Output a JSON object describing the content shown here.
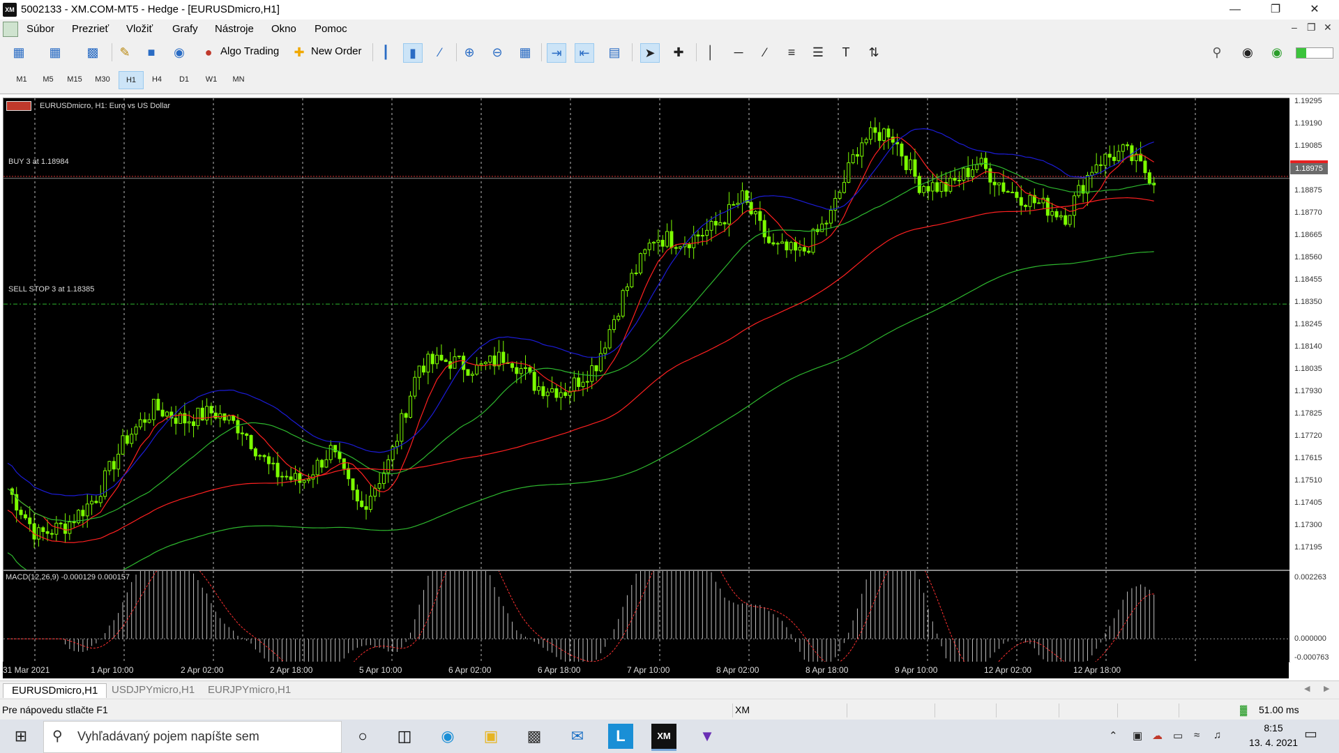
{
  "window": {
    "title": "5002133 - XM.COM-MT5 - Hedge - [EURUSDmicro,H1]",
    "app_icon": "XM"
  },
  "menu": [
    "Súbor",
    "Prezrieť",
    "Vložiť",
    "Grafy",
    "Nástroje",
    "Okno",
    "Pomoc"
  ],
  "toolbar": {
    "algo_trading": "Algo Trading",
    "new_order": "New Order"
  },
  "timeframes": [
    "M1",
    "M5",
    "M15",
    "M30",
    "H1",
    "H4",
    "D1",
    "W1",
    "MN"
  ],
  "active_timeframe": "H1",
  "chart": {
    "symbol_label": "EURUSDmicro, H1:  Euro vs US Dollar",
    "buy_label": "BUY 3 at 1.18984",
    "sell_stop_label": "SELL STOP 3 at 1.18385",
    "current_price": "1.18975",
    "macd_label": "MACD(12,26,9) -0.000129 0.000157",
    "y_labels": [
      "1.19295",
      "1.19190",
      "1.19085",
      "1.18980",
      "1.18875",
      "1.18770",
      "1.18665",
      "1.18560",
      "1.18455",
      "1.18350",
      "1.18245",
      "1.18140",
      "1.18035",
      "1.17930",
      "1.17825",
      "1.17720",
      "1.17615",
      "1.17510",
      "1.17405",
      "1.17300",
      "1.17195"
    ],
    "macd_y_labels": [
      "0.002263",
      "0.000000",
      "-0.000763"
    ],
    "x_labels": [
      "31 Mar 2021",
      "1 Apr 10:00",
      "2 Apr 02:00",
      "2 Apr 18:00",
      "5 Apr 10:00",
      "6 Apr 02:00",
      "6 Apr 18:00",
      "7 Apr 10:00",
      "8 Apr 02:00",
      "8 Apr 18:00",
      "9 Apr 10:00",
      "12 Apr 02:00",
      "12 Apr 18:00"
    ]
  },
  "chart_data": {
    "type": "candlestick",
    "symbol": "EURUSDmicro",
    "timeframe": "H1",
    "ylim": [
      1.1714,
      1.1935
    ],
    "close_approx": [
      1.1752,
      1.173,
      1.1735,
      1.1748,
      1.1775,
      1.179,
      1.1784,
      1.1788,
      1.178,
      1.176,
      1.1755,
      1.177,
      1.1742,
      1.1765,
      1.181,
      1.1812,
      1.1808,
      1.1815,
      1.18,
      1.1798,
      1.181,
      1.1845,
      1.187,
      1.1868,
      1.1874,
      1.1888,
      1.1865,
      1.1862,
      1.188,
      1.1915,
      1.192,
      1.1895,
      1.1893,
      1.1905,
      1.1892,
      1.1886,
      1.188,
      1.1905,
      1.191,
      1.1897
    ],
    "buy_level": 1.18984,
    "sell_stop_level": 1.18385,
    "current_price": 1.18975,
    "macd": {
      "params": "12,26,9",
      "main": -0.000129,
      "signal": 0.000157,
      "ylim": [
        -0.000763,
        0.002263
      ]
    }
  },
  "tabs": [
    "EURUSDmicro,H1",
    "USDJPYmicro,H1",
    "EURJPYmicro,H1"
  ],
  "status": {
    "help": "Pre nápovedu stlačte F1",
    "server": "XM",
    "ping": "51.00 ms"
  },
  "taskbar": {
    "search_placeholder": "Vyhľadávaný pojem napíšte sem",
    "time": "8:15",
    "date": "13. 4. 2021"
  },
  "colors": {
    "bull_candle": "#7cfc00",
    "ma_red": "#ff2020",
    "ma_blue": "#1c1cd8",
    "ma_green": "#2eb82e",
    "macd_hist": "#c0c0c0",
    "macd_signal": "#ff3030"
  }
}
